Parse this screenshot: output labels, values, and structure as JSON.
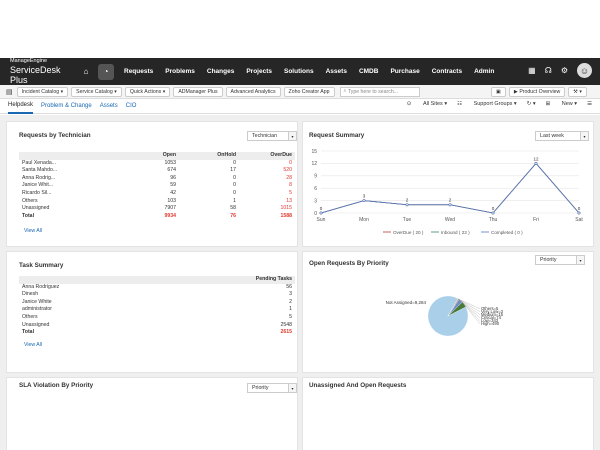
{
  "brand": {
    "line1": "ManageEngine",
    "line2": "ServiceDesk Plus"
  },
  "nav": [
    "Requests",
    "Problems",
    "Changes",
    "Projects",
    "Solutions",
    "Assets",
    "CMDB",
    "Purchase",
    "Contracts",
    "Admin"
  ],
  "toolbar": {
    "buttons": [
      "Incident Catalog",
      "Service Catalog",
      "Quick Actions",
      "ADManager Plus",
      "Advanced Analytics",
      "Zoho Creator App"
    ],
    "search_placeholder": "Type here to search...",
    "product_overview": "Product Overview"
  },
  "subtabs": [
    "Helpdesk",
    "Problem & Change",
    "Assets",
    "CIO"
  ],
  "subtab_right": {
    "sites": "All Sites",
    "groups": "Support Groups",
    "new": "New"
  },
  "technician": {
    "title": "Requests by Technician",
    "filter": "Technician",
    "headers": [
      "",
      "Open",
      "OnHold",
      "OverDue"
    ],
    "rows": [
      [
        "Paul Xenada...",
        "1053",
        "0",
        "0"
      ],
      [
        "Santa Mahdo...",
        "674",
        "17",
        "520"
      ],
      [
        "Anna Rodrig...",
        "96",
        "0",
        "28"
      ],
      [
        "Janice Whit...",
        "59",
        "0",
        "8"
      ],
      [
        "Ricardo Sil...",
        "42",
        "0",
        "5"
      ],
      [
        "Others",
        "103",
        "1",
        "13"
      ],
      [
        "Unassigned",
        "7907",
        "58",
        "1015"
      ],
      [
        "Total",
        "9934",
        "76",
        "1588"
      ]
    ],
    "view_all": "View All"
  },
  "summary": {
    "title": "Request Summary",
    "filter": "Last week",
    "chart_data": {
      "type": "line",
      "categories": [
        "Sun",
        "Mon",
        "Tue",
        "Wed",
        "Thu",
        "Fri",
        "Sat"
      ],
      "ylim": [
        0,
        15
      ],
      "yticks": [
        "15",
        "12",
        "9",
        "6",
        "3",
        "0"
      ],
      "series": [
        {
          "name": "OverDue ( 20 )",
          "color": "#c0392b",
          "values": [
            0,
            3,
            2,
            2,
            0,
            12,
            0
          ]
        },
        {
          "name": "Inbound ( 23 )",
          "color": "#2e8b57",
          "values": [
            0,
            3,
            2,
            2,
            0,
            12,
            0
          ]
        },
        {
          "name": "Completed ( 0 )",
          "color": "#5b77c9",
          "values": [
            0,
            3,
            2,
            2,
            0,
            12,
            0
          ]
        }
      ]
    }
  },
  "task": {
    "title": "Task Summary",
    "header": "Pending Tasks",
    "rows": [
      [
        "Anna Rodriguez",
        "56"
      ],
      [
        "Dinesh",
        "3"
      ],
      [
        "Janice White",
        "2"
      ],
      [
        "administrator",
        "1"
      ],
      [
        "Others",
        "5"
      ],
      [
        "Unassigned",
        "2548"
      ],
      [
        "Total",
        "2615"
      ]
    ],
    "view_all": "View All"
  },
  "priority": {
    "title": "Open Requests By Priority",
    "filter": "Priority",
    "chart_data": {
      "type": "pie",
      "labels": [
        "Not Assigned",
        "Others",
        "Very Low",
        "Medium",
        "Critical",
        "Low",
        "High"
      ],
      "values": [
        9284,
        5,
        3,
        15,
        74,
        343,
        490
      ],
      "colors": [
        "#a9cfe9",
        "#8bbc4a",
        "#f0c43b",
        "#3aa0a0",
        "#c0392b",
        "#6a8fc7",
        "#4a7a3a"
      ],
      "slice_labels": [
        "Not Assigned=9,284",
        "Others=5",
        "Very Low=3",
        "Medium=15",
        "Critical=74",
        "Low=343",
        "High=490"
      ]
    }
  },
  "sla": {
    "title": "SLA Violation By Priority",
    "filter": "Priority"
  },
  "unassigned": {
    "title": "Unassigned And Open Requests"
  }
}
